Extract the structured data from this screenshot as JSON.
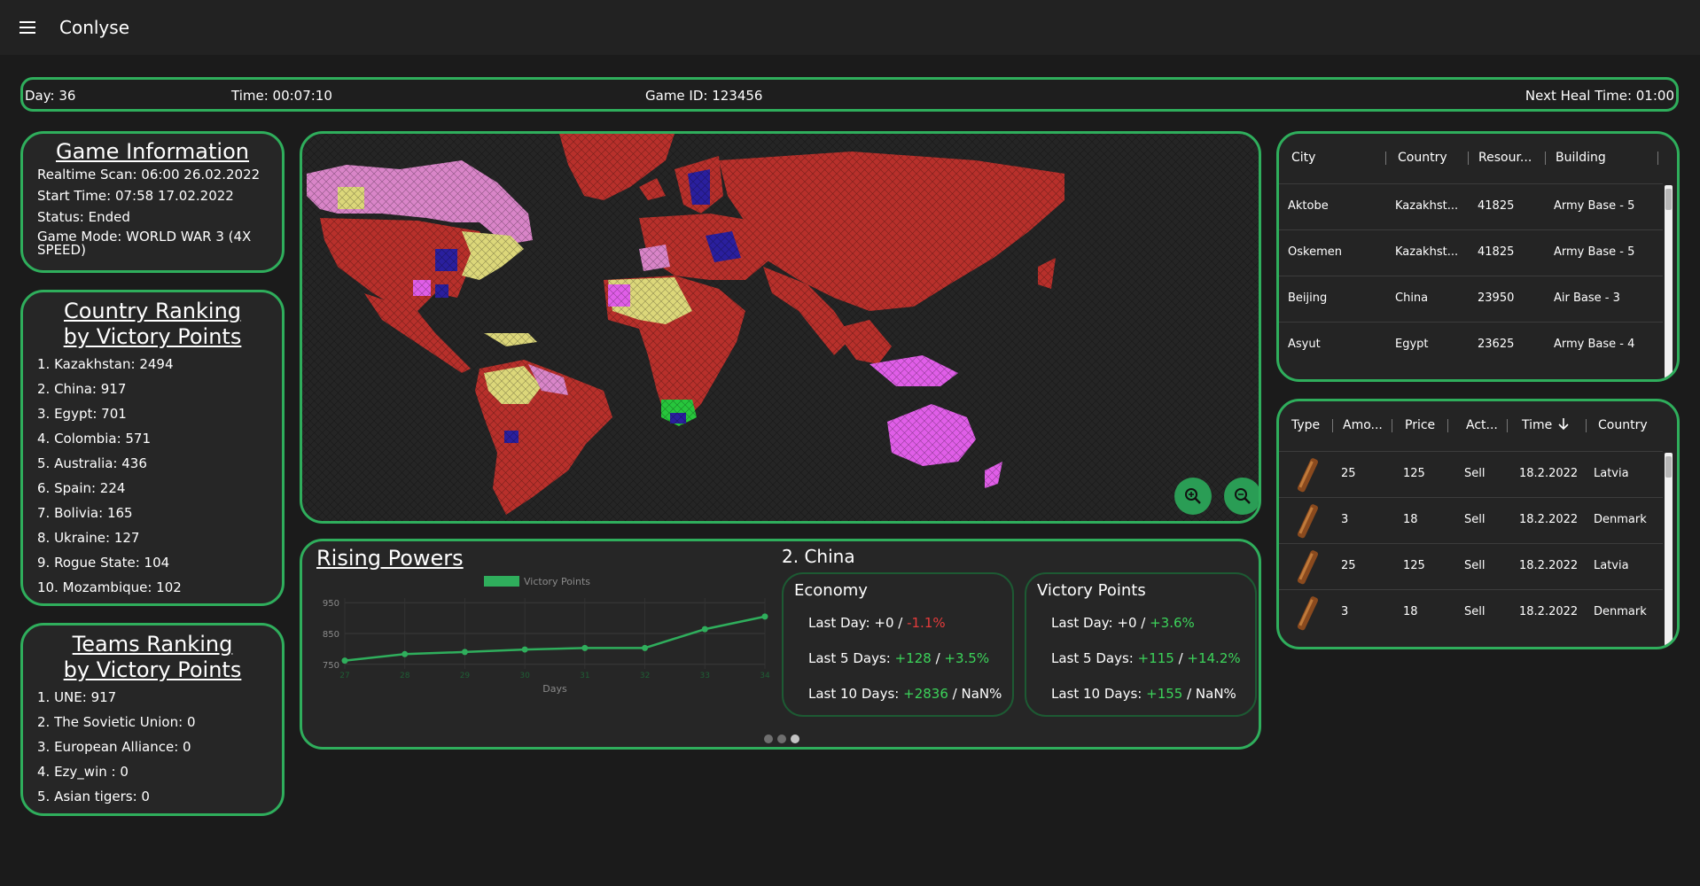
{
  "app": {
    "title": "Conlyse",
    "menu_icon": "hamburger-icon"
  },
  "status": {
    "day": "Day: 36",
    "time": "Time: 00:07:10",
    "game_id": "Game ID: 123456",
    "heal_time": "Next Heal Time: 01:00"
  },
  "game_info": {
    "title": "Game Information",
    "lines": [
      "Realtime Scan: 06:00 26.02.2022",
      "Start Time: 07:58 17.02.2022",
      "Status: Ended",
      "Game Mode: WORLD WAR 3 (4X SPEED)"
    ]
  },
  "country_ranking": {
    "title_line1": "Country Ranking",
    "title_line2": "by Victory Points",
    "items": [
      "1. Kazakhstan: 2494",
      "2. China: 917",
      "3. Egypt: 701",
      "4. Colombia: 571",
      "5. Australia: 436",
      "6. Spain: 224",
      "7. Bolivia: 165",
      "8. Ukraine: 127",
      "9. Rogue State: 104",
      "10. Mozambique: 102"
    ]
  },
  "team_ranking": {
    "title_line1": "Teams Ranking",
    "title_line2": "by Victory Points",
    "items": [
      "1. UNE: 917",
      "2. The Sovietic Union: 0",
      "3. European Alliance: 0",
      "4. Ezy_win : 0",
      "5. Asian tigers: 0"
    ]
  },
  "map": {
    "zoom_in_icon": "zoom-in-icon",
    "zoom_out_icon": "zoom-out-icon",
    "colors": {
      "main_red": "#b8302b",
      "pink": "#d985c8",
      "yellow": "#dcd77a",
      "navy": "#2a1f9e",
      "magenta": "#e05ee8",
      "green": "#27c63c"
    }
  },
  "rising_powers": {
    "title": "Rising Powers",
    "country_title": "2. China",
    "economy": {
      "title": "Economy",
      "last_day": {
        "label": "Last Day: ",
        "abs": "+0",
        "sep": " / ",
        "pct": "-1.1%"
      },
      "last_5": {
        "label": "Last 5 Days: ",
        "abs": "+128",
        "sep": " / ",
        "pct": "+3.5%"
      },
      "last_10": {
        "label": "Last 10 Days: ",
        "abs": "+2836",
        "sep": " / ",
        "pct": "NaN%"
      }
    },
    "victory": {
      "title": "Victory Points",
      "last_day": {
        "label": "Last Day: ",
        "abs": "+0",
        "sep": " / ",
        "pct": "+3.6%"
      },
      "last_5": {
        "label": "Last 5 Days: ",
        "abs": "+115",
        "sep": " / ",
        "pct": "+14.2%"
      },
      "last_10": {
        "label": "Last 10 Days: ",
        "abs": "+155",
        "sep": " / ",
        "pct": "NaN%"
      }
    },
    "carousel": {
      "count": 3,
      "active": 2
    }
  },
  "chart_data": {
    "type": "line",
    "title": "",
    "xlabel": "Days",
    "ylabel": "",
    "x": [
      27,
      28,
      29,
      30,
      31,
      32,
      33,
      34
    ],
    "series": [
      {
        "name": "Victory Points",
        "values": [
          762,
          783,
          790,
          798,
          803,
          803,
          864,
          905
        ],
        "color": "#2fae5c"
      }
    ],
    "y_ticks": [
      750,
      850,
      950
    ],
    "ylim": [
      735,
      965
    ],
    "grid": true,
    "legend": "top-center"
  },
  "cities_table": {
    "headers": [
      "City",
      "Country",
      "Resour...",
      "Building"
    ],
    "rows": [
      [
        "Aktobe",
        "Kazakhst...",
        "41825",
        "Army Base - 5"
      ],
      [
        "Oskemen",
        "Kazakhst...",
        "41825",
        "Army Base - 5"
      ],
      [
        "Beijing",
        "China",
        "23950",
        "Air Base - 3"
      ],
      [
        "Asyut",
        "Egypt",
        "23625",
        "Army Base - 4"
      ]
    ]
  },
  "trades_table": {
    "headers": [
      "Type",
      "Amo...",
      "Price",
      "Act...",
      "Time",
      "Country"
    ],
    "sort_icon": "arrow-down-icon",
    "item_icon": "oil-barrel-icon",
    "rows": [
      [
        "25",
        "125",
        "Sell",
        "18.2.2022",
        "Latvia"
      ],
      [
        "3",
        "18",
        "Sell",
        "18.2.2022",
        "Denmark"
      ],
      [
        "25",
        "125",
        "Sell",
        "18.2.2022",
        "Latvia"
      ],
      [
        "3",
        "18",
        "Sell",
        "18.2.2022",
        "Denmark"
      ]
    ]
  }
}
